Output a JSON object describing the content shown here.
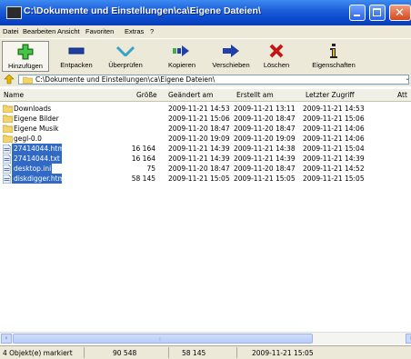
{
  "window": {
    "title": "C:\\Dokumente und Einstellungen\\ca\\Eigene Dateien\\",
    "app_icon_text": "7z"
  },
  "menu": [
    "Datei",
    "Bearbeiten",
    "Ansicht",
    "Favoriten",
    "Extras",
    "?"
  ],
  "toolbar": {
    "add": "Hinzufügen",
    "extract": "Entpacken",
    "test": "Überprüfen",
    "copy": "Kopieren",
    "move": "Verschieben",
    "delete": "Löschen",
    "properties": "Eigenschaften"
  },
  "address": {
    "path": "C:\\Dokumente und Einstellungen\\ca\\Eigene Dateien\\"
  },
  "columns": {
    "name": "Name",
    "size": "Größe",
    "modified": "Geändert am",
    "created": "Erstellt am",
    "accessed": "Letzter Zugriff",
    "attributes": "Att"
  },
  "files": [
    {
      "name": "Downloads",
      "size": "",
      "modified": "2009-11-21 14:53",
      "created": "2009-11-21 13:11",
      "accessed": "2009-11-21 14:53",
      "type": "folder",
      "selected": false
    },
    {
      "name": "Eigene Bilder",
      "size": "",
      "modified": "2009-11-21 15:06",
      "created": "2009-11-20 18:47",
      "accessed": "2009-11-21 15:06",
      "type": "folder",
      "selected": false
    },
    {
      "name": "Eigene Musik",
      "size": "",
      "modified": "2009-11-20 18:47",
      "created": "2009-11-20 18:47",
      "accessed": "2009-11-21 14:06",
      "type": "folder",
      "selected": false
    },
    {
      "name": "gegl-0.0",
      "size": "",
      "modified": "2009-11-20 19:09",
      "created": "2009-11-20 19:09",
      "accessed": "2009-11-21 14:06",
      "type": "folder",
      "selected": false
    },
    {
      "name": "27414044.htm",
      "size": "16 164",
      "modified": "2009-11-21 14:39",
      "created": "2009-11-21 14:38",
      "accessed": "2009-11-21 15:04",
      "type": "file",
      "selected": true
    },
    {
      "name": "27414044.txt",
      "size": "16 164",
      "modified": "2009-11-21 14:39",
      "created": "2009-11-21 14:39",
      "accessed": "2009-11-21 14:39",
      "type": "file",
      "selected": true
    },
    {
      "name": "desktop.ini",
      "size": "75",
      "modified": "2009-11-20 18:47",
      "created": "2009-11-20 18:47",
      "accessed": "2009-11-21 14:52",
      "type": "file",
      "selected": true
    },
    {
      "name": "diskdigger.htm",
      "size": "58 145",
      "modified": "2009-11-21 15:05",
      "created": "2009-11-21 15:05",
      "accessed": "2009-11-21 15:05",
      "type": "file",
      "selected": true
    }
  ],
  "status": {
    "selection": "4 Objekt(e) markiert",
    "total_size": "90 548",
    "focused_size": "58 145",
    "focused_date": "2009-11-21 15:05"
  },
  "colors": {
    "titlebar": "#0c4bd0",
    "selection": "#316ac5",
    "chrome": "#ece9d8"
  }
}
